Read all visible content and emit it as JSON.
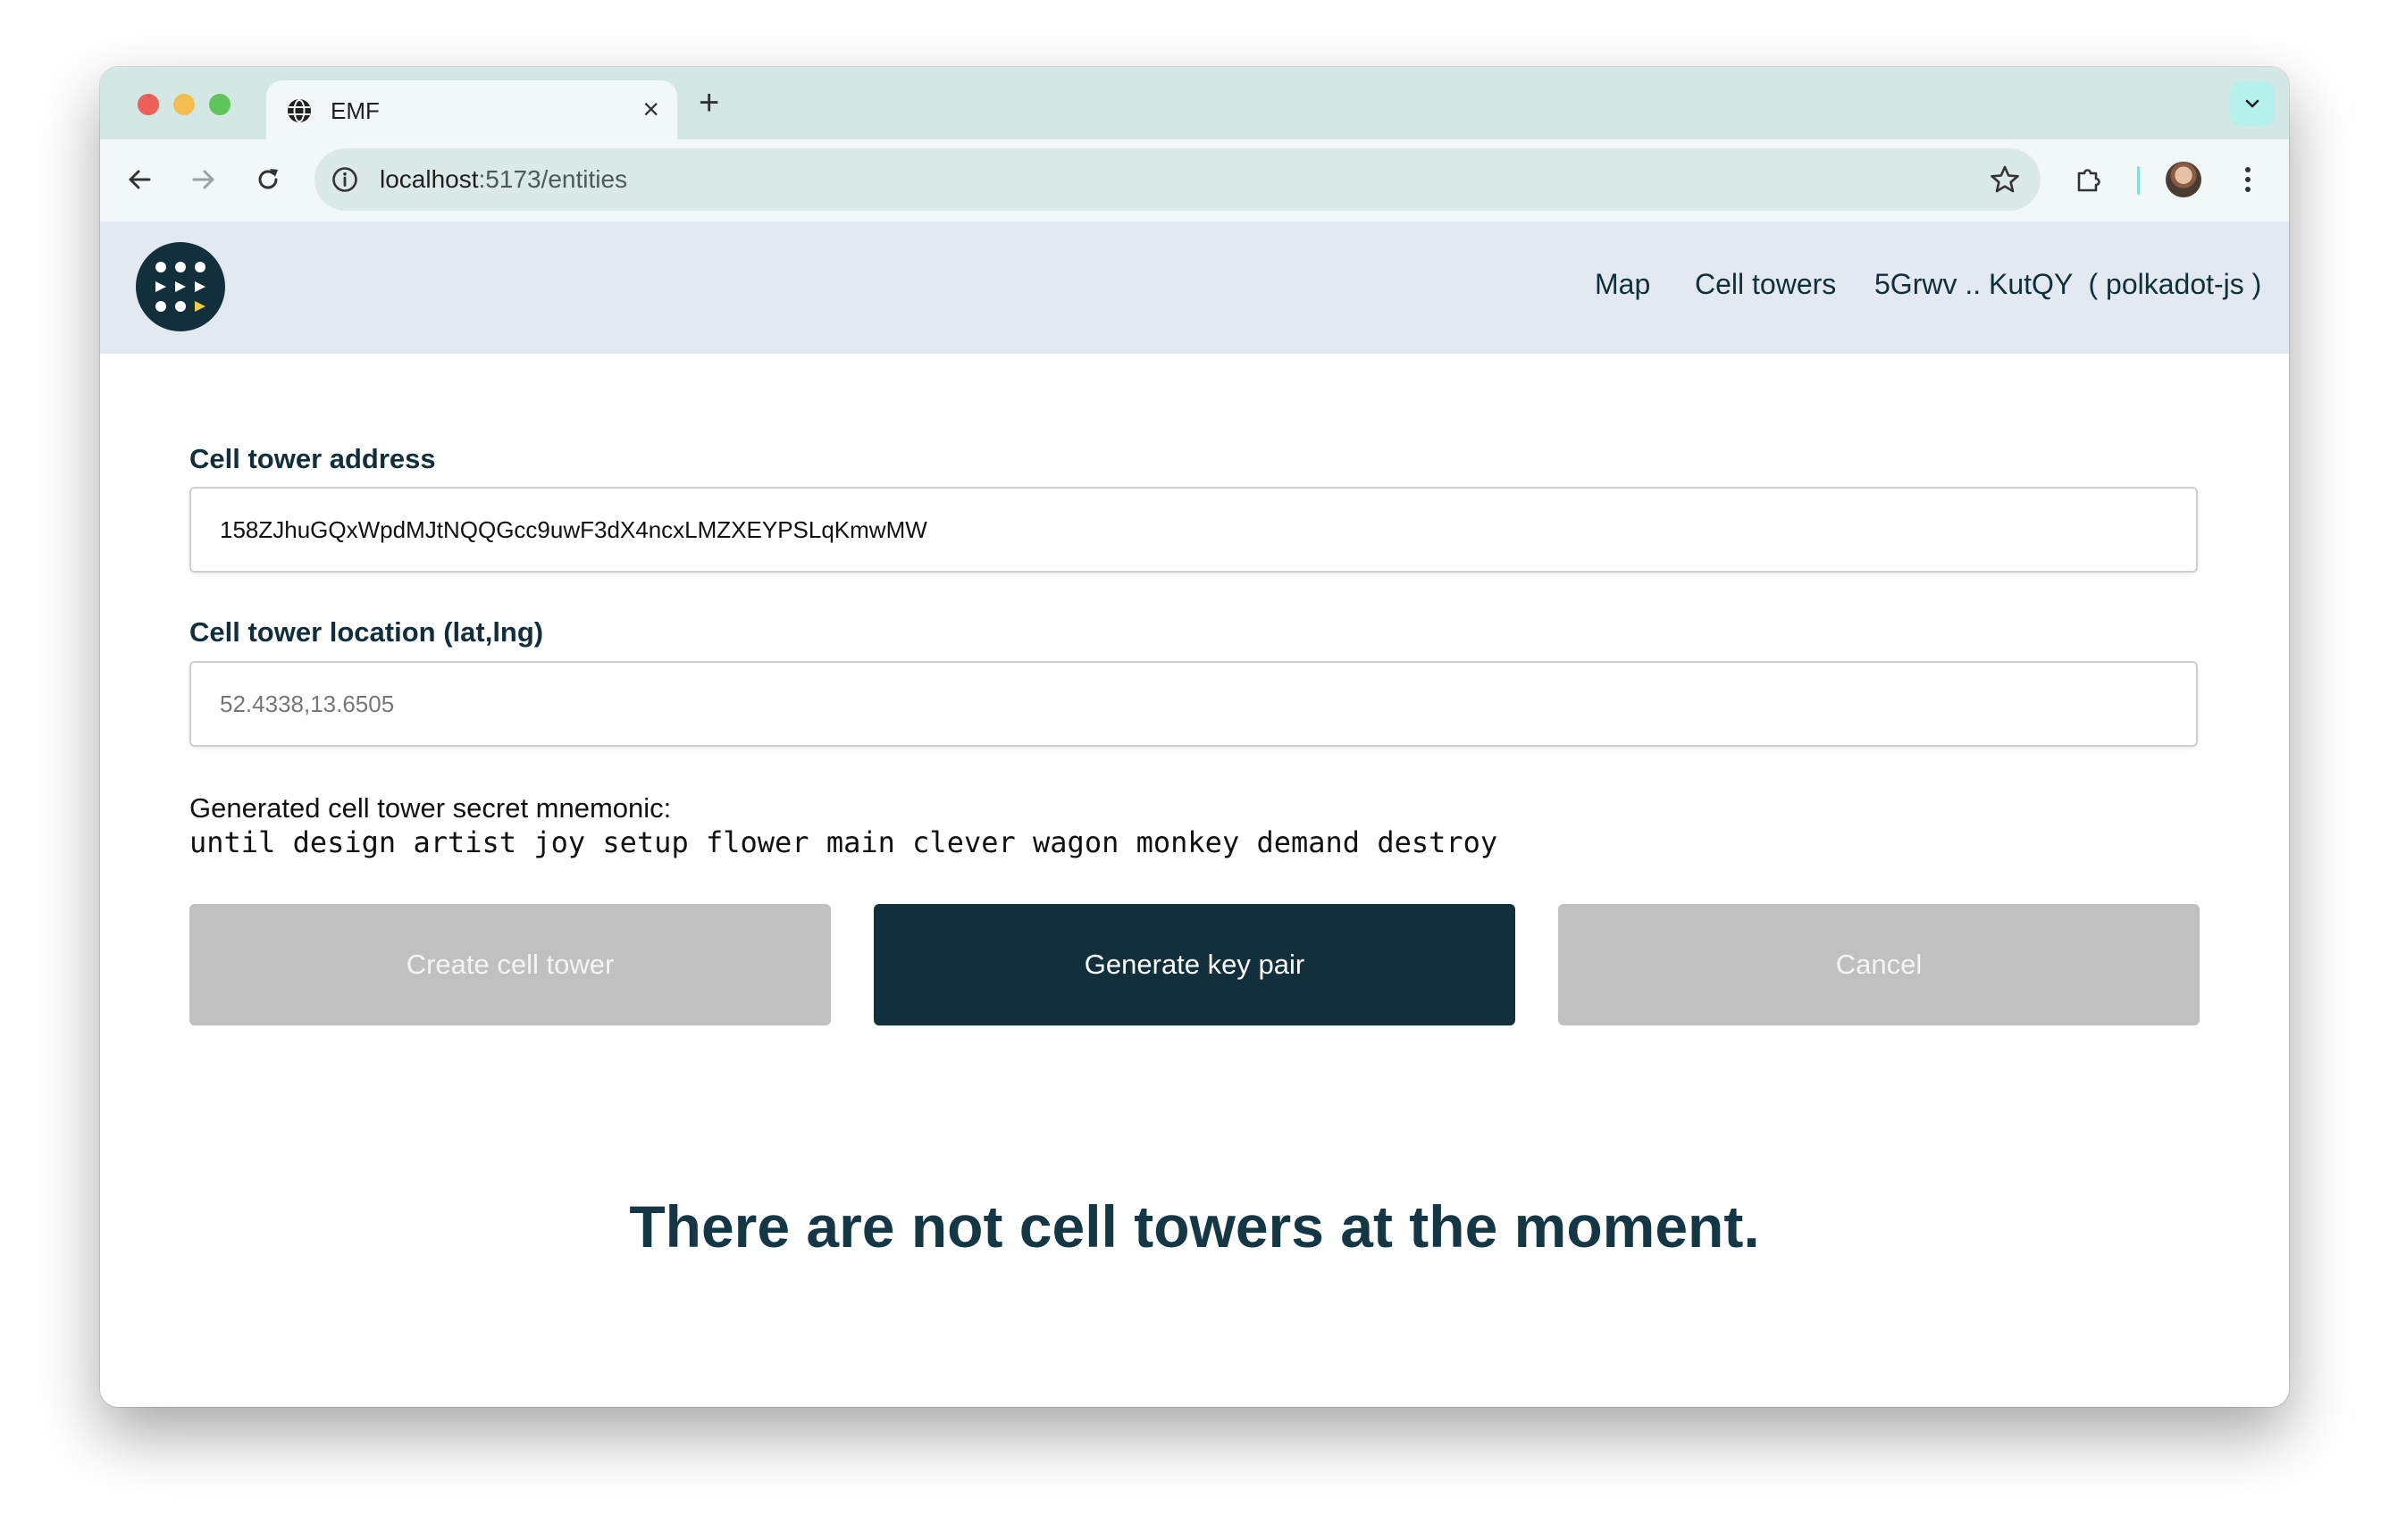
{
  "browser": {
    "tab_title": "EMF",
    "tab_close": "×",
    "new_tab": "+",
    "url_host": "localhost",
    "url_rest": ":5173/entities"
  },
  "app": {
    "nav": {
      "map": "Map",
      "cell_towers": "Cell towers",
      "account": "5Grwv .. KutQY  ( polkadot-js )"
    },
    "form": {
      "address_label": "Cell tower address",
      "address_value": "158ZJhuGQxWpdMJtNQQGcc9uwF3dX4ncxLMZXEYPSLqKmwMW",
      "location_label": "Cell tower location (lat,lng)",
      "location_placeholder": "52.4338,13.6505",
      "mnemonic_label": "Generated cell tower secret mnemonic:",
      "mnemonic_value": "until design artist joy setup flower main clever wagon monkey demand destroy"
    },
    "buttons": {
      "create": "Create cell tower",
      "generate": "Generate key pair",
      "cancel": "Cancel"
    },
    "empty_message": "There are not cell towers at the moment."
  },
  "colors": {
    "primary": "#12303c",
    "disabled": "#c0c0c0",
    "header_bg": "#e3e9f1"
  }
}
